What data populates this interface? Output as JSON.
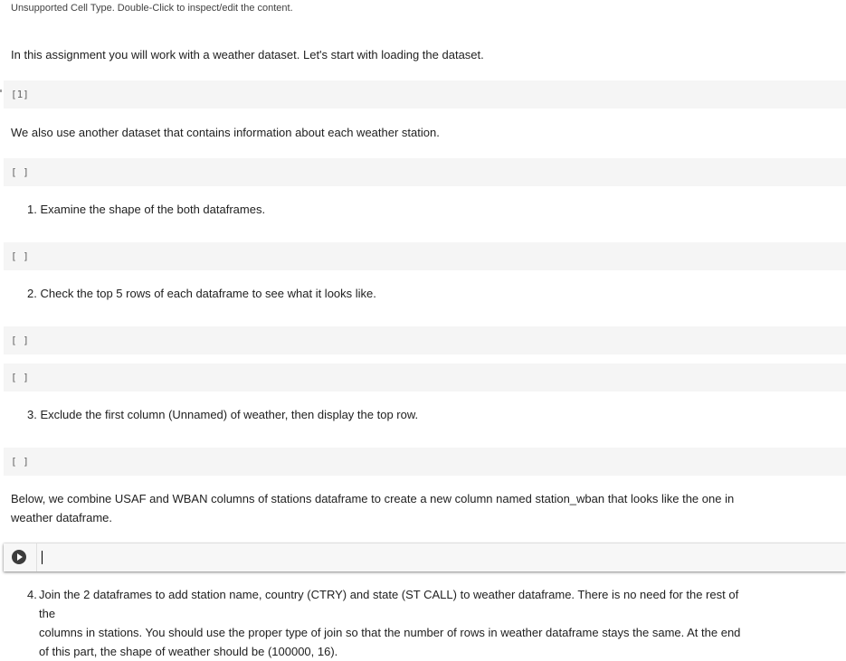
{
  "notice": "Unsupported Cell Type. Double-Click to inspect/edit the content.",
  "intro_text": "In this assignment you will work with a weather dataset. Let's start with loading the dataset.",
  "cell1_count": "[1]",
  "stations_text": "We also use another dataset that contains information about each weather station.",
  "empty_count": "[ ]",
  "q1": {
    "num": "1.",
    "text": "Examine the shape of the both dataframes."
  },
  "q2": {
    "num": "2.",
    "text": "Check the top 5 rows of each dataframe to see what it looks like."
  },
  "q3": {
    "num": "3.",
    "text": "Exclude the first column (Unnamed) of weather, then display the top row."
  },
  "combine_text_line1": "Below, we combine USAF and WBAN columns of stations dataframe to create a new column named station_wban that looks like the one in",
  "combine_text_line2": "weather dataframe.",
  "q4": {
    "num": "4.",
    "line1": "Join the 2 dataframes to add station name, country (CTRY) and state (ST CALL) to weather dataframe. There is no need for the rest of the",
    "line2": "columns in stations. You should use the proper type of join so that the number of rows in weather dataframe stays the same. At the end",
    "line3": "of this part, the shape of weather should be (100000, 16)."
  },
  "icons": {
    "run": "play-circle-icon"
  }
}
